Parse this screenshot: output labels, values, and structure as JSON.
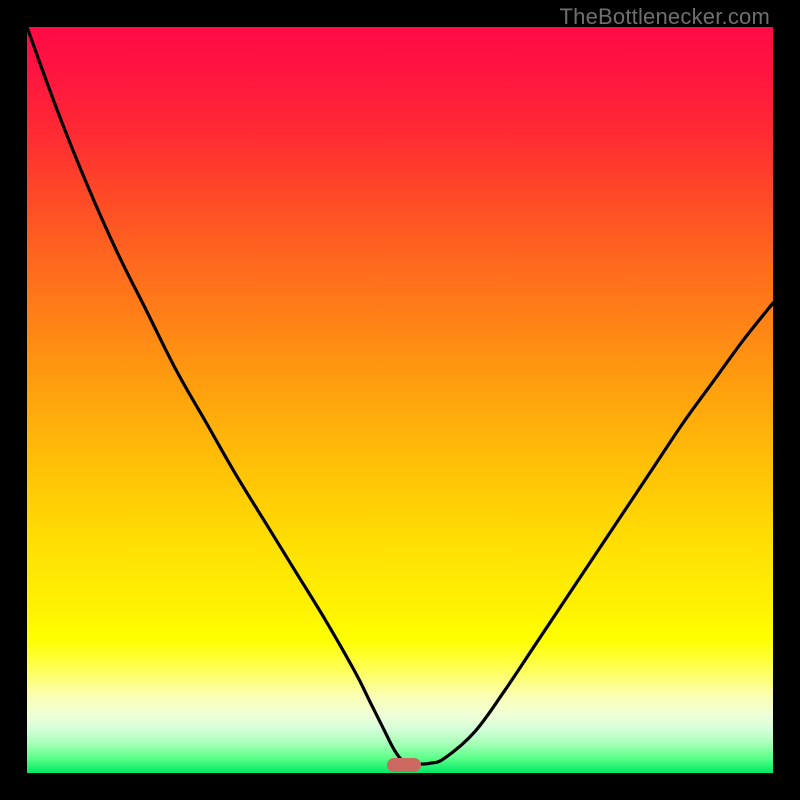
{
  "attribution": "TheBottlenecker.com",
  "colors": {
    "frame": "#000000",
    "curve": "#000000",
    "marker": "#cc6a62"
  },
  "chart_data": {
    "type": "line",
    "title": "",
    "xlabel": "",
    "ylabel": "",
    "xlim": [
      0,
      100
    ],
    "ylim": [
      0,
      100
    ],
    "legend": false,
    "grid": false,
    "background": "rainbow-gradient (red top → green bottom)",
    "series": [
      {
        "name": "bottleneck-curve",
        "x": [
          0,
          4,
          8,
          12,
          16,
          20,
          24,
          28,
          32,
          36,
          40,
          44,
          46,
          48,
          49,
          50,
          51,
          52,
          54,
          56,
          60,
          64,
          68,
          72,
          76,
          80,
          84,
          88,
          92,
          96,
          100
        ],
        "y": [
          100,
          89,
          79,
          70,
          62,
          54,
          47,
          40,
          33.5,
          27,
          20.5,
          13.5,
          9.5,
          5.5,
          3.5,
          2.0,
          1.4,
          1.2,
          1.3,
          2.0,
          5.5,
          11,
          17,
          23,
          29,
          35,
          41,
          47,
          52.5,
          58,
          63
        ]
      }
    ],
    "annotations": [
      {
        "name": "optimal-marker",
        "x": 50.5,
        "y": 1.1,
        "shape": "rounded-pill"
      }
    ]
  }
}
